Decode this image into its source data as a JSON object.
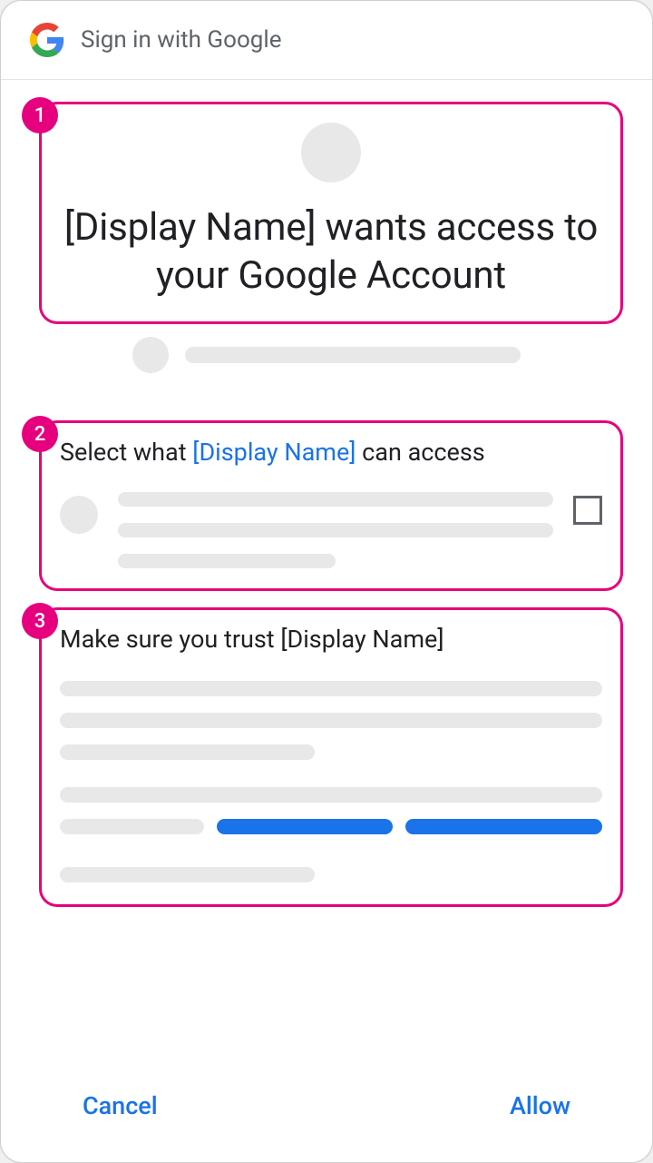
{
  "header": {
    "title": "Sign in with Google"
  },
  "annotations": {
    "badge1": "1",
    "badge2": "2",
    "badge3": "3"
  },
  "section1": {
    "heading": "[Display Name] wants access to your Google Account"
  },
  "section2": {
    "heading_prefix": "Select what ",
    "heading_link": "[Display Name]",
    "heading_suffix": " can access"
  },
  "section3": {
    "heading": "Make sure you trust [Display Name]"
  },
  "footer": {
    "cancel": "Cancel",
    "allow": "Allow"
  },
  "colors": {
    "accent": "#e6007e",
    "link": "#1a73e8",
    "placeholder": "#e8e8e8"
  }
}
